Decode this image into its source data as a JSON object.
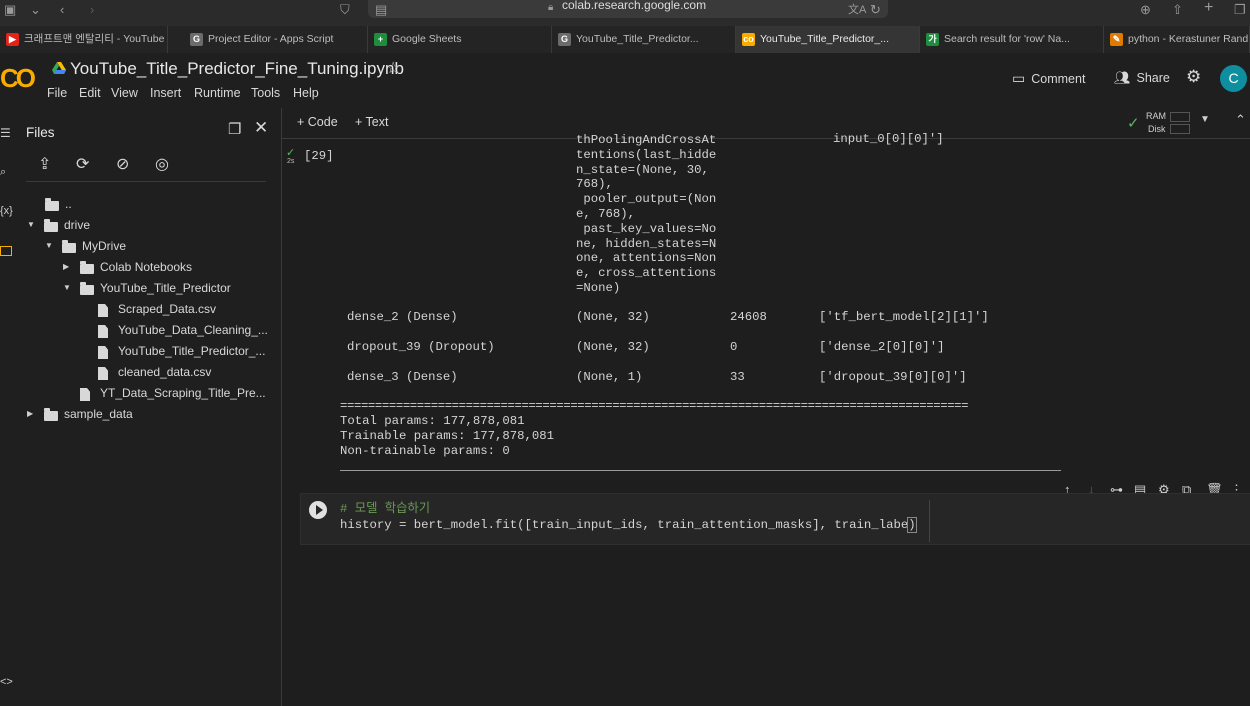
{
  "browser": {
    "url": "colab.research.google.com"
  },
  "tabs": [
    {
      "label": "크래프트맨 엔탈리티 - YouTube",
      "icon_color": "#e62117",
      "icon_glyph": "▶"
    },
    {
      "label": "Project Editor - Apps Script",
      "icon_color": "#6b6b6b",
      "icon_glyph": "G"
    },
    {
      "label": "Google Sheets",
      "icon_color": "#1e8e3e",
      "icon_glyph": "+"
    },
    {
      "label": "YouTube_Title_Predictor...",
      "icon_color": "#6b6b6b",
      "icon_glyph": "G"
    },
    {
      "label": "YouTube_Title_Predictor_...",
      "icon_color": "#f9ab00",
      "icon_glyph": "co",
      "active": true
    },
    {
      "label": "Search result for 'row' Na...",
      "icon_color": "#1e8e3e",
      "icon_glyph": "가"
    },
    {
      "label": "python - Kerastuner Rand...",
      "icon_color": "#e07b00",
      "icon_glyph": "✎"
    }
  ],
  "header": {
    "logo": "CO",
    "notebook_title": "YouTube_Title_Predictor_Fine_Tuning.ipynb",
    "menu": [
      "File",
      "Edit",
      "View",
      "Insert",
      "Runtime",
      "Tools",
      "Help"
    ],
    "comment_label": "Comment",
    "share_label": "Share",
    "avatar_letter": "C"
  },
  "files_panel": {
    "title": "Files",
    "tree": [
      {
        "label": "..",
        "kind": "folder-up",
        "depth": 0
      },
      {
        "label": "drive",
        "kind": "folder",
        "depth": 0,
        "expanded": true
      },
      {
        "label": "MyDrive",
        "kind": "folder",
        "depth": 1,
        "expanded": true
      },
      {
        "label": "Colab Notebooks",
        "kind": "folder",
        "depth": 2,
        "expanded": false
      },
      {
        "label": "YouTube_Title_Predictor",
        "kind": "folder",
        "depth": 2,
        "expanded": true
      },
      {
        "label": "Scraped_Data.csv",
        "kind": "file",
        "depth": 3
      },
      {
        "label": "YouTube_Data_Cleaning_...",
        "kind": "file",
        "depth": 3
      },
      {
        "label": "YouTube_Title_Predictor_...",
        "kind": "file",
        "depth": 3
      },
      {
        "label": "cleaned_data.csv",
        "kind": "file",
        "depth": 3
      },
      {
        "label": "YT_Data_Scraping_Title_Pre...",
        "kind": "file",
        "depth": 2
      },
      {
        "label": "sample_data",
        "kind": "folder",
        "depth": 0,
        "expanded": false
      }
    ]
  },
  "toolbar": {
    "add_code": "+ Code",
    "add_text": "+ Text",
    "ram_label": "RAM",
    "disk_label": "Disk"
  },
  "output_cell": {
    "exec_count": "[29]",
    "exec_time": "2s",
    "wrapped_output": [
      "thPoolingAndCrossAt",
      "tentions(last_hidde",
      "n_state=(None, 30,",
      "768),",
      " pooler_output=(Non",
      "e, 768),",
      " past_key_values=No",
      "ne, hidden_states=N",
      "one, attentions=Non",
      "e, cross_attentions",
      "=None)"
    ],
    "top_connected": "input_0[0][0]']",
    "layers": [
      {
        "name": "dense_2 (Dense)",
        "shape": "(None, 32)",
        "params": "24608",
        "connected": "['tf_bert_model[2][1]']"
      },
      {
        "name": "dropout_39 (Dropout)",
        "shape": "(None, 32)",
        "params": "0",
        "connected": "['dense_2[0][0]']"
      },
      {
        "name": "dense_3 (Dense)",
        "shape": "(None, 1)",
        "params": "33",
        "connected": "['dropout_39[0][0]']"
      }
    ],
    "separator": "==========================================================================================",
    "total_params": "Total params: 177,878,081",
    "trainable_params": "Trainable params: 177,878,081",
    "non_trainable_params": "Non-trainable params: 0"
  },
  "code_cell": {
    "comment": "# 모델 학습하기",
    "code": "history = bert_model.fit([train_input_ids, train_attention_masks], train_labe",
    "code_tail": ")"
  }
}
